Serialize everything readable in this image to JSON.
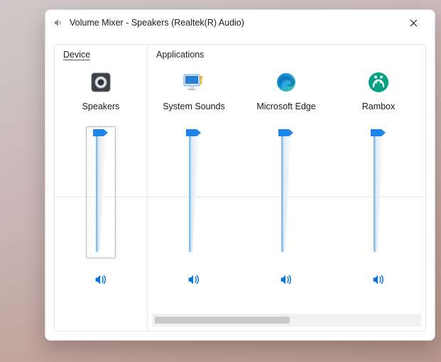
{
  "window": {
    "title": "Volume Mixer - Speakers (Realtek(R) Audio)"
  },
  "sections": {
    "device_label": "Device",
    "applications_label": "Applications"
  },
  "device": {
    "name": "Speakers",
    "icon": "speaker-device-icon",
    "volume": 100,
    "muted": false,
    "focused": true
  },
  "applications": [
    {
      "name": "System Sounds",
      "icon": "system-sounds-icon",
      "volume": 100,
      "muted": false
    },
    {
      "name": "Microsoft Edge",
      "icon": "edge-icon",
      "volume": 100,
      "muted": false
    },
    {
      "name": "Rambox",
      "icon": "rambox-icon",
      "volume": 100,
      "muted": false
    }
  ],
  "colors": {
    "accent": "#0a73d9",
    "slider_fill": "#2e8ee6"
  }
}
